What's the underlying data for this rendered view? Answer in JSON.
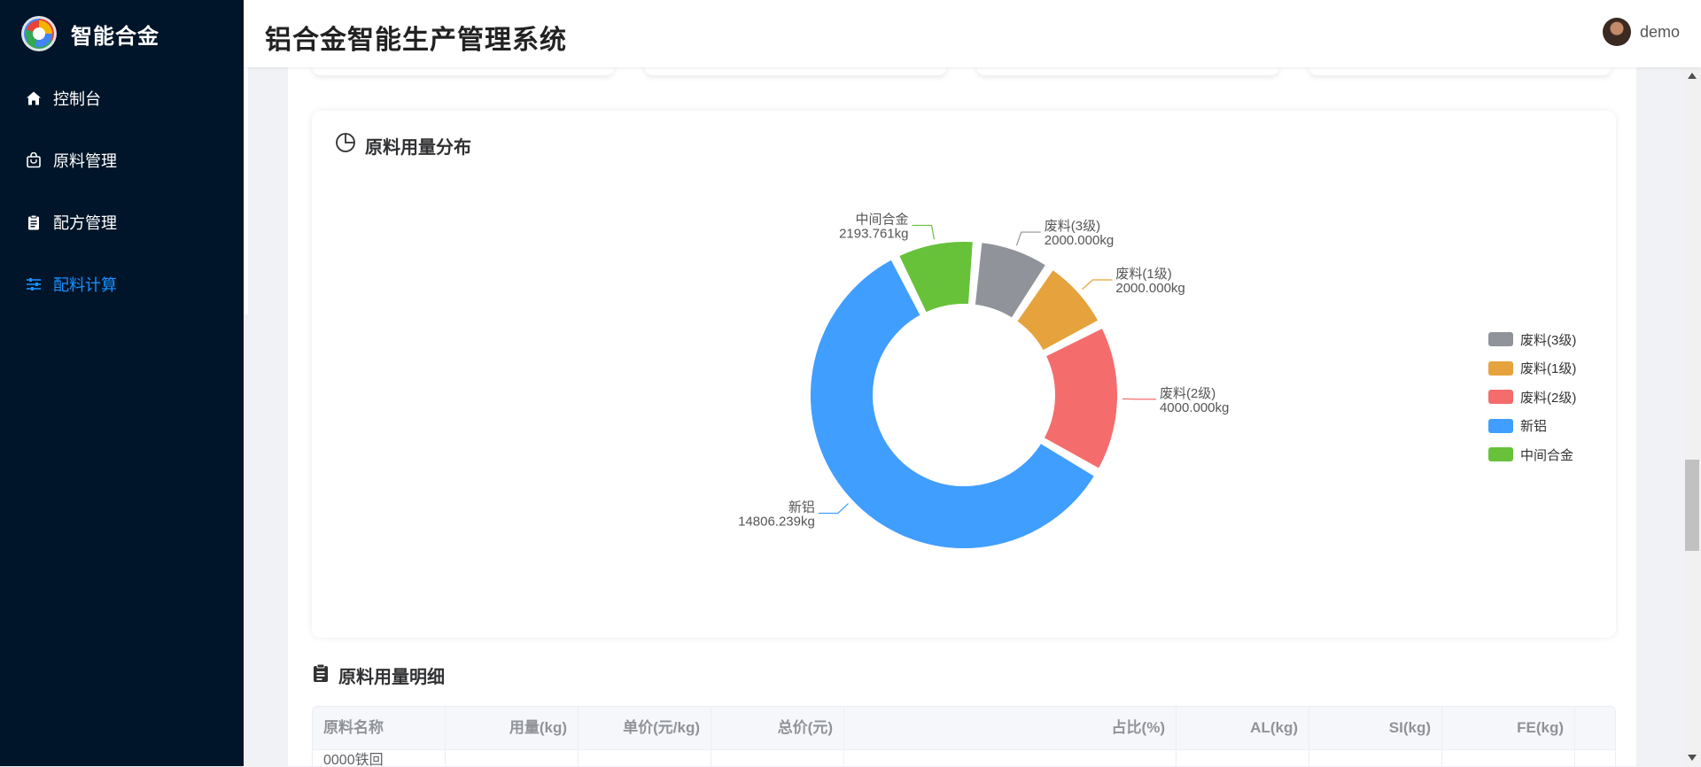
{
  "sidebar": {
    "brand": "智能合金",
    "items": [
      {
        "label": "控制台",
        "icon": "home-icon",
        "active": false
      },
      {
        "label": "原料管理",
        "icon": "bag-icon",
        "active": false
      },
      {
        "label": "配方管理",
        "icon": "clipboard-icon",
        "active": false
      },
      {
        "label": "配料计算",
        "icon": "sliders-icon",
        "active": true
      }
    ]
  },
  "header": {
    "title": "铝合金智能生产管理系统",
    "user": "demo"
  },
  "distribution": {
    "title": "原料用量分布",
    "icon": "pie-chart-icon"
  },
  "chart_data": {
    "type": "pie",
    "donut": true,
    "legend_position": "right",
    "unit": "kg",
    "slices": [
      {
        "name": "废料(3级)",
        "value": 2000.0,
        "label": "2000.000kg",
        "color": "#909399"
      },
      {
        "name": "废料(1级)",
        "value": 2000.0,
        "label": "2000.000kg",
        "color": "#e6a23c"
      },
      {
        "name": "废料(2级)",
        "value": 4000.0,
        "label": "4000.000kg",
        "color": "#f56c6c"
      },
      {
        "name": "新铝",
        "value": 14806.239,
        "label": "14806.239kg",
        "color": "#409eff"
      },
      {
        "name": "中间合金",
        "value": 2193.761,
        "label": "2193.761kg",
        "color": "#67c23a"
      }
    ]
  },
  "detail": {
    "title": "原料用量明细",
    "icon": "clipboard-icon",
    "columns": [
      "原料名称",
      "用量(kg)",
      "单价(元/kg)",
      "总价(元)",
      "占比(%)",
      "AL(kg)",
      "SI(kg)",
      "FE(kg)",
      ""
    ],
    "first_row": [
      "0000铁回",
      "",
      "",
      "",
      "",
      "",
      "",
      "",
      ""
    ]
  }
}
